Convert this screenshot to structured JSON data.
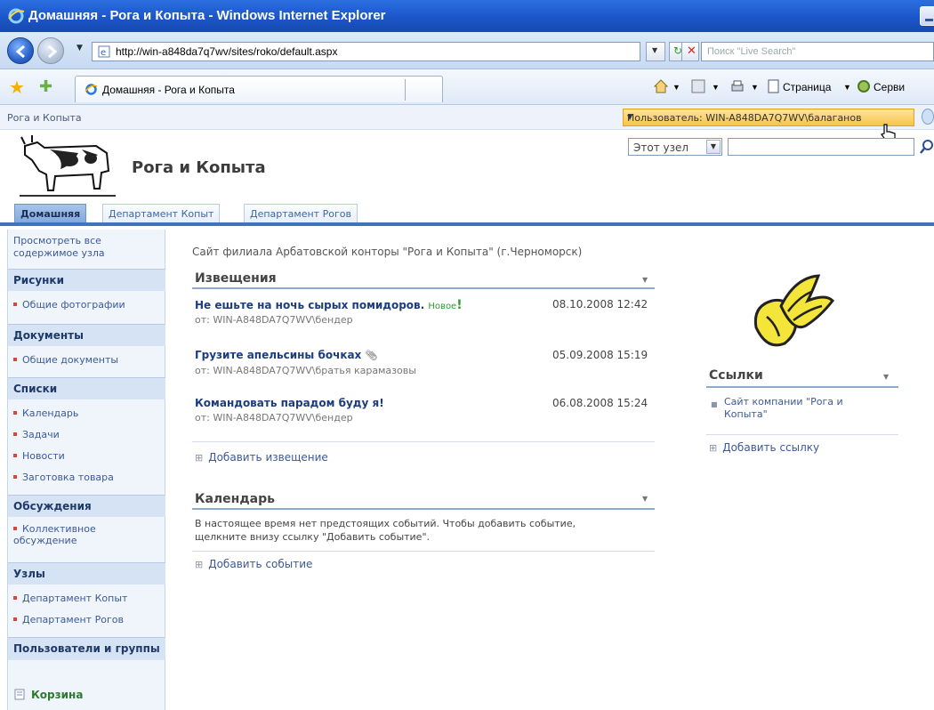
{
  "browser": {
    "title": "Домашняя - Рога и Копыта - Windows Internet Explorer",
    "url": "http://win-a848da7q7wv/sites/roko/default.aspx",
    "search_placeholder": "Поиск \"Live Search\"",
    "tab_label": "Домашняя - Рога и Копыта",
    "page_menu": "Страница",
    "service_menu": "Серви"
  },
  "site": {
    "breadcrumb": "Рога и Копыта",
    "user_menu": "Пользователь: WIN-A848DA7Q7WV\\балаганов",
    "title": "Рога и Копыта",
    "search_scope": "Этот узел",
    "nav_tabs": [
      "Домашняя",
      "Департамент Копыт",
      "Департамент Рогов"
    ]
  },
  "quicklaunch": {
    "view_all": "Просмотреть все содержимое узла",
    "pictures_header": "Рисунки",
    "pictures_items": [
      "Общие фотографии"
    ],
    "documents_header": "Документы",
    "documents_items": [
      "Общие документы"
    ],
    "lists_header": "Списки",
    "lists_items": [
      "Календарь",
      "Задачи",
      "Новости",
      "Заготовка товара"
    ],
    "discussions_header": "Обсуждения",
    "discussions_items": [
      "Коллективное обсуждение"
    ],
    "sites_header": "Узлы",
    "sites_items": [
      "Департамент Копыт",
      "Департамент Рогов"
    ],
    "people_header": "Пользователи и группы",
    "recycle": "Корзина"
  },
  "main": {
    "description": "Сайт филиала Арбатовской конторы \"Рога и Копыта\" (г.Черноморск)",
    "announcements": {
      "title": "Извещения",
      "items": [
        {
          "title": "Не ешьте на ночь сырых помидоров.",
          "badge": "Новое",
          "by": "от: WIN-A848DA7Q7WV\\бендер",
          "date": "08.10.2008 12:42"
        },
        {
          "title": "Грузите апельсины бочках",
          "by": "от: WIN-A848DA7Q7WV\\братья карамазовы",
          "date": "05.09.2008 15:19"
        },
        {
          "title": "Командовать парадом буду я!",
          "by": "от: WIN-A848DA7Q7WV\\бендер",
          "date": "06.08.2008 15:24"
        }
      ],
      "add_link": "Добавить извещение"
    },
    "calendar": {
      "title": "Календарь",
      "text_line1": "В настоящее время нет предстоящих событий. Чтобы добавить событие,",
      "text_line2": "щелкните внизу ссылку \"Добавить событие\".",
      "add_link": "Добавить событие"
    }
  },
  "links": {
    "title": "Ссылки",
    "items": [
      "Сайт компании \"Рога и Копыта\""
    ],
    "add_link": "Добавить ссылку"
  }
}
